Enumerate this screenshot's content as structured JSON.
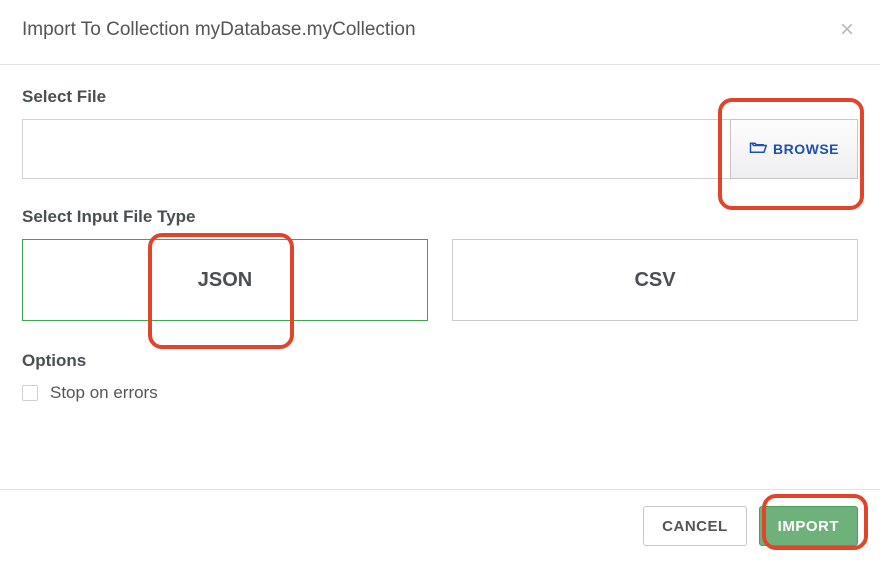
{
  "header": {
    "title": "Import To Collection myDatabase.myCollection"
  },
  "file": {
    "label": "Select File",
    "value": "",
    "browse_label": "BROWSE"
  },
  "filetype": {
    "label": "Select Input File Type",
    "json_label": "JSON",
    "csv_label": "CSV"
  },
  "options": {
    "label": "Options",
    "stop_on_errors_label": "Stop on errors"
  },
  "footer": {
    "cancel_label": "CANCEL",
    "import_label": "IMPORT"
  }
}
